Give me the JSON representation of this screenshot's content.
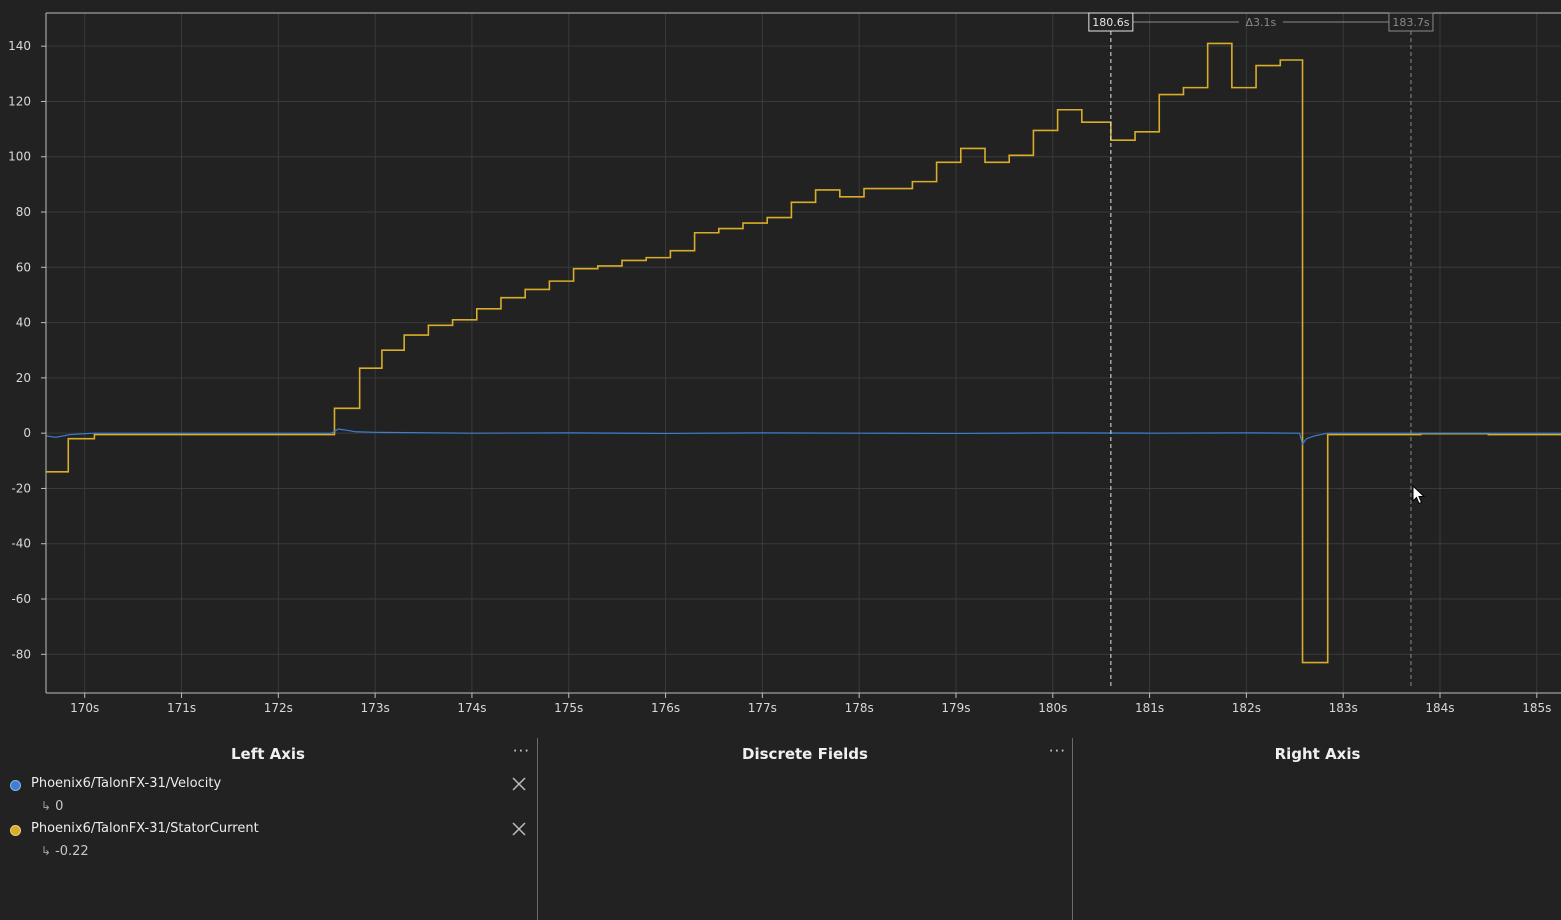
{
  "plot": {
    "colors": {
      "background": "#222222",
      "grid": "#3a3a3a",
      "axis": "#bdbdbd",
      "velocity": "#3d7fd0",
      "current": "#d9ad2a",
      "marker_primary": "#e6e6e6",
      "marker_secondary": "#8a8a8a"
    },
    "selection": {
      "primary_label": "180.6s",
      "primary_time": 180.6,
      "secondary_label": "183.7s",
      "secondary_time": 183.7,
      "delta_label": "Δ3.1s"
    }
  },
  "chart_data": {
    "type": "line",
    "xlim": [
      169.6,
      185.25
    ],
    "ylim": [
      -94,
      152
    ],
    "x_ticks": [
      170,
      171,
      172,
      173,
      174,
      175,
      176,
      177,
      178,
      179,
      180,
      181,
      182,
      183,
      184,
      185
    ],
    "x_tick_labels": [
      "170s",
      "171s",
      "172s",
      "173s",
      "174s",
      "175s",
      "176s",
      "177s",
      "178s",
      "179s",
      "180s",
      "181s",
      "182s",
      "183s",
      "184s",
      "185s"
    ],
    "y_ticks": [
      -80,
      -60,
      -40,
      -20,
      0,
      20,
      40,
      60,
      80,
      100,
      120,
      140
    ],
    "y_tick_labels": [
      "-80",
      "-60",
      "-40",
      "-20",
      "0",
      "20",
      "40",
      "60",
      "80",
      "100",
      "120",
      "140"
    ],
    "grid": true,
    "series": [
      {
        "name": "Phoenix6/TalonFX-31/StatorCurrent",
        "color": "#d9ad2a",
        "step": true,
        "x": [
          169.6,
          169.83,
          170.1,
          172.58,
          172.84,
          173.07,
          173.3,
          173.55,
          173.8,
          174.05,
          174.3,
          174.55,
          174.8,
          175.05,
          175.3,
          175.55,
          175.8,
          176.05,
          176.3,
          176.55,
          176.8,
          177.05,
          177.3,
          177.55,
          177.8,
          178.05,
          178.3,
          178.55,
          178.8,
          179.05,
          179.3,
          179.55,
          179.8,
          180.05,
          180.3,
          180.6,
          180.85,
          181.1,
          181.35,
          181.6,
          181.85,
          182.1,
          182.35,
          182.58,
          182.84,
          183.8,
          184.5,
          185.25
        ],
        "y": [
          -14,
          -2,
          -0.5,
          9,
          23.5,
          30,
          35.5,
          39,
          41,
          45,
          49,
          52,
          55,
          59.5,
          60.5,
          62.5,
          63.5,
          66,
          72.5,
          74,
          76,
          78,
          83.5,
          88,
          85.5,
          88.5,
          88.5,
          91,
          98,
          103,
          98,
          100.5,
          109.5,
          117,
          112.5,
          106,
          109,
          122.5,
          125,
          141,
          125,
          133,
          135,
          -83,
          -0.5,
          -0.2,
          -0.5,
          -0.5
        ]
      },
      {
        "name": "Phoenix6/TalonFX-31/Velocity",
        "color": "#3d7fd0",
        "step": false,
        "x": [
          169.6,
          169.7,
          169.85,
          170.1,
          172.55,
          172.62,
          172.68,
          172.8,
          173.0,
          174.0,
          175.0,
          176.0,
          177.0,
          178.0,
          179.0,
          180.0,
          181.0,
          182.0,
          182.55,
          182.58,
          182.62,
          182.7,
          182.84,
          183.5,
          184.5,
          185.25
        ],
        "y": [
          -1,
          -1.5,
          -0.5,
          0,
          0,
          1.5,
          1.2,
          0.5,
          0.3,
          0,
          0.1,
          -0.1,
          0.1,
          0,
          -0.1,
          0.1,
          0,
          0.1,
          0,
          -4,
          -2,
          -1,
          0,
          0,
          0,
          0
        ]
      }
    ]
  },
  "left_axis": {
    "title": "Left Axis",
    "more_glyph": "···",
    "fields": [
      {
        "name": "Phoenix6/TalonFX-31/Velocity",
        "value": "0",
        "color": "#3d7fd0"
      },
      {
        "name": "Phoenix6/TalonFX-31/StatorCurrent",
        "value": "-0.22",
        "color": "#d9ad2a"
      }
    ]
  },
  "discrete_fields": {
    "title": "Discrete Fields",
    "more_glyph": "···"
  },
  "right_axis": {
    "title": "Right Axis"
  },
  "icons": {
    "more": "more-horizontal-icon",
    "remove": "close-icon",
    "value_arrow": "return-arrow-icon",
    "cursor": "mouse-pointer-icon"
  }
}
